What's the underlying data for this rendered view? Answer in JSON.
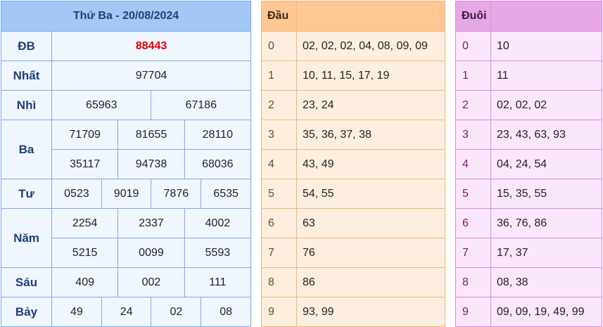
{
  "results": {
    "title": "Thứ Ba - 20/08/2024",
    "prizes": {
      "db": {
        "label": "ĐB",
        "values": [
          "88443"
        ]
      },
      "nhat": {
        "label": "Nhất",
        "values": [
          "97704"
        ]
      },
      "nhi": {
        "label": "Nhì",
        "values": [
          "65963",
          "67186"
        ]
      },
      "ba": {
        "label": "Ba",
        "values": [
          "71709",
          "81655",
          "28110",
          "35117",
          "94738",
          "68036"
        ]
      },
      "tu": {
        "label": "Tư",
        "values": [
          "0523",
          "9019",
          "7876",
          "6535"
        ]
      },
      "nam": {
        "label": "Năm",
        "values": [
          "2254",
          "2337",
          "4002",
          "5215",
          "0099",
          "5593"
        ]
      },
      "sau": {
        "label": "Sáu",
        "values": [
          "409",
          "002",
          "111"
        ]
      },
      "bay": {
        "label": "Bảy",
        "values": [
          "49",
          "24",
          "02",
          "08"
        ]
      }
    }
  },
  "head": {
    "title": "Đầu",
    "rows": [
      {
        "key": "0",
        "value": "02, 02, 02, 04, 08, 09, 09"
      },
      {
        "key": "1",
        "value": "10, 11, 15, 17, 19"
      },
      {
        "key": "2",
        "value": "23, 24"
      },
      {
        "key": "3",
        "value": "35, 36, 37, 38"
      },
      {
        "key": "4",
        "value": "43, 49"
      },
      {
        "key": "5",
        "value": "54, 55"
      },
      {
        "key": "6",
        "value": "63"
      },
      {
        "key": "7",
        "value": "76"
      },
      {
        "key": "8",
        "value": "86"
      },
      {
        "key": "9",
        "value": "93, 99"
      }
    ]
  },
  "tail": {
    "title": "Đuôi",
    "rows": [
      {
        "key": "0",
        "value": "10"
      },
      {
        "key": "1",
        "value": "11"
      },
      {
        "key": "2",
        "value": "02, 02, 02"
      },
      {
        "key": "3",
        "value": "23, 43, 63, 93"
      },
      {
        "key": "4",
        "value": "04, 24, 54"
      },
      {
        "key": "5",
        "value": "15, 35, 55"
      },
      {
        "key": "6",
        "value": "36, 76, 86"
      },
      {
        "key": "7",
        "value": "17, 37"
      },
      {
        "key": "8",
        "value": "08, 38"
      },
      {
        "key": "9",
        "value": "09, 09, 19, 49, 99"
      }
    ]
  },
  "colors": {
    "results_header": "#a4c8f6",
    "special_prize": "#e00000",
    "head_header": "#ffc793",
    "tail_header": "#e7a8e7"
  }
}
